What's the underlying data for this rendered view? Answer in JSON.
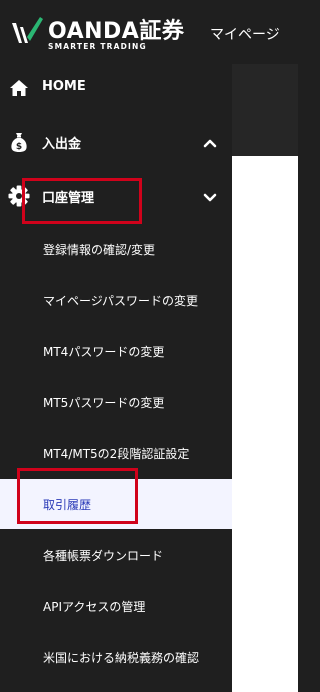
{
  "header": {
    "brand": "OANDA証券",
    "tagline": "SMARTER TRADING",
    "mypage_label": "マイページ"
  },
  "sidebar": {
    "top_items": [
      {
        "label": "HOME",
        "icon": "home-icon"
      },
      {
        "label": "入出金",
        "icon": "money-bag-icon",
        "chevron": "chevron-up-icon",
        "expanded": false
      },
      {
        "label": "口座管理",
        "icon": "gear-icon",
        "chevron": "chevron-down-icon",
        "expanded": true
      }
    ],
    "sub_items": [
      {
        "label": "登録情報の確認/変更"
      },
      {
        "label": "マイページパスワードの変更"
      },
      {
        "label": "MT4パスワードの変更"
      },
      {
        "label": "MT5パスワードの変更"
      },
      {
        "label": "MT4/MT5の2段階認証設定"
      },
      {
        "label": "取引履歴",
        "active": true
      },
      {
        "label": "各種帳票ダウンロード"
      },
      {
        "label": "APIアクセスの管理"
      },
      {
        "label": "米国における納税義務の確認"
      }
    ]
  },
  "colors": {
    "sidebar_bg": "#1f1f1f",
    "active_bg": "#f3f4ff",
    "active_text": "#2b3bb8",
    "highlight": "#d0021b",
    "brand_green": "#2bb673"
  }
}
